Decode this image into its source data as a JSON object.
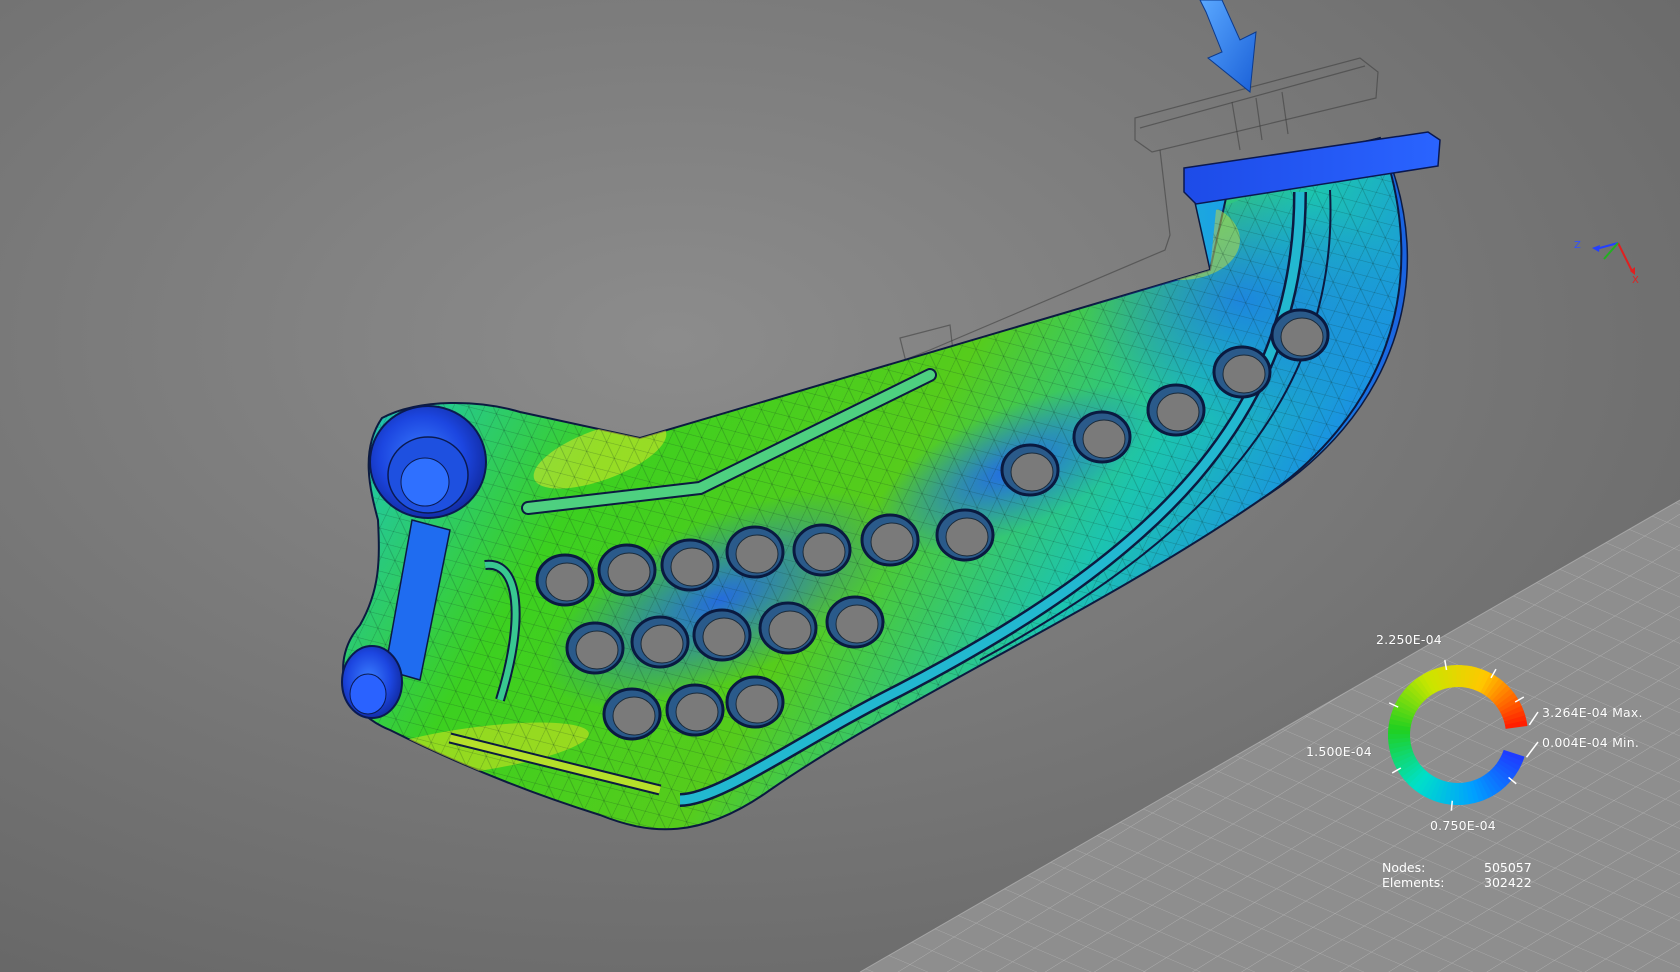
{
  "legend": {
    "ticks": [
      "2.250E-04",
      "1.500E-04",
      "0.750E-04"
    ],
    "max_label": "3.264E-04 Max.",
    "min_label": "0.004E-04 Min.",
    "gradient_colors": [
      "#1e3cff",
      "#00a0ff",
      "#00e0c8",
      "#20d020",
      "#c8e600",
      "#ffc800",
      "#ff1e00"
    ]
  },
  "stats": {
    "nodes_label": "Nodes:",
    "nodes_value": "505057",
    "elements_label": "Elements:",
    "elements_value": "302422"
  },
  "axis_triad": {
    "z_label": "Z",
    "x_label": "X"
  },
  "load_arrow": {
    "color": "#2e7de8"
  },
  "model": {
    "hole_count": 20
  }
}
